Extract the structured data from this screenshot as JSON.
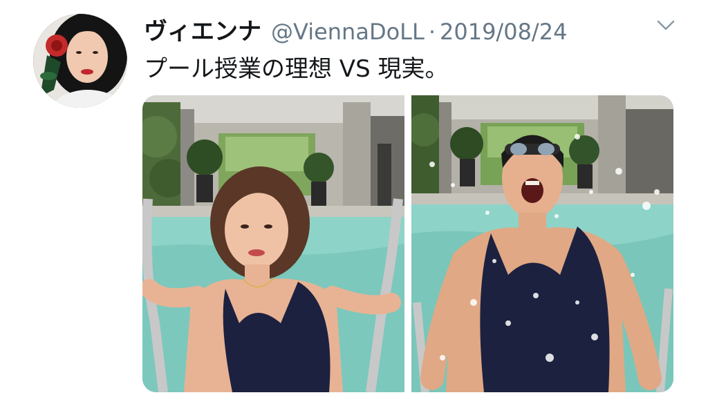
{
  "tweet": {
    "display_name": "ヴィエンナ",
    "handle": "@ViennaDoLL",
    "separator": "·",
    "date": "2019/08/24",
    "text": "プール授業の理想 VS 現実。"
  },
  "icons": {
    "more": "chevron-down-icon"
  },
  "media": {
    "count": 2,
    "items": [
      {
        "name": "ideal-photo",
        "alt_subject": "posing-in-pool"
      },
      {
        "name": "reality-photo",
        "alt_subject": "splashing-in-pool"
      }
    ]
  },
  "colors": {
    "name": "#14171a",
    "secondary": "#657786",
    "water": "#8ed3c8",
    "swimsuit": "#1d2140"
  }
}
